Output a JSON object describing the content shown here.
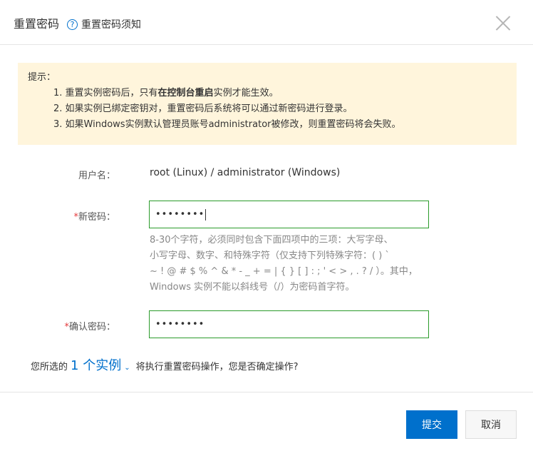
{
  "header": {
    "title": "重置密码",
    "help_icon": "?",
    "help_text": "重置密码须知"
  },
  "notice": {
    "heading": "提示：",
    "item1_prefix": "1. 重置实例密码后，只有",
    "item1_bold": "在控制台重启",
    "item1_suffix": "实例才能生效。",
    "item2": "2. 如果实例已绑定密钥对，重置密码后系统将可以通过新密码进行登录。",
    "item3": "3. 如果Windows实例默认管理员账号administrator被修改，则重置密码将会失败。"
  },
  "form": {
    "username_label": "用户名：",
    "username_value": "root (Linux) / administrator (Windows)",
    "required_mark": "*",
    "new_password_label": "新密码：",
    "new_password_value": "••••••••",
    "hint_line1": "8-30个字符，必须同时包含下面四项中的三项：大写字母、",
    "hint_line2": "小写字母、数字、和特殊字符（仅支持下列特殊字符：( ) `",
    "hint_line3": "~ ! @ # $ % ^ & * - _ + = | { } [ ] : ; ' < > , . ? / ）。其中，",
    "hint_line4": "Windows 实例不能以斜线号（/）为密码首字符。",
    "confirm_password_label": "确认密码：",
    "confirm_password_value": "••••••••"
  },
  "confirm": {
    "prefix": "您所选的",
    "link": "1 个实例",
    "suffix": "将执行重置密码操作，您是否确定操作?"
  },
  "footer": {
    "submit_label": "提交",
    "cancel_label": "取消"
  },
  "colors": {
    "primary": "#0070cc",
    "notice_bg": "#fff5dc",
    "input_border_valid": "#2b9b2b",
    "required": "#e4393c"
  }
}
